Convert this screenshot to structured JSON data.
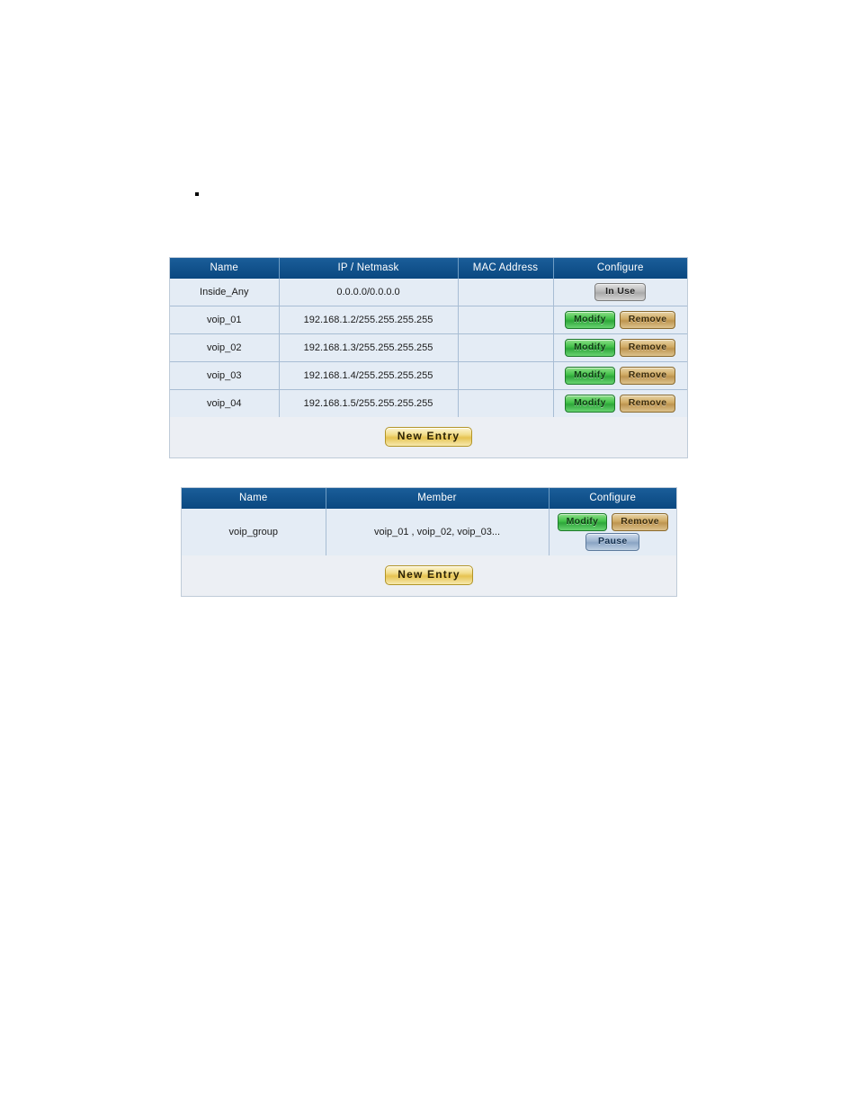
{
  "page": {
    "bullet_marker": "▪"
  },
  "colors": {
    "header_blue": "#0e4d85",
    "cell_blue": "#e4ecf5",
    "panel_gray": "#eceff4",
    "grid_line": "#a8bdd4",
    "modify_green": "#3fbf46",
    "remove_tan": "#cfa962",
    "inuse_gray": "#b9b9b9",
    "pause_blue": "#9db4cf",
    "newentry_gold": "#e6c351"
  },
  "address_table": {
    "columns": [
      "Name",
      "IP / Netmask",
      "MAC Address",
      "Configure"
    ],
    "rows": [
      {
        "name": "Inside_Any",
        "ip_netmask": "0.0.0.0/0.0.0.0",
        "mac_address": "",
        "actions": [
          {
            "label": "In Use",
            "style": "inuse"
          }
        ]
      },
      {
        "name": "voip_01",
        "ip_netmask": "192.168.1.2/255.255.255.255",
        "mac_address": "",
        "actions": [
          {
            "label": "Modify",
            "style": "modify"
          },
          {
            "label": "Remove",
            "style": "remove"
          }
        ]
      },
      {
        "name": "voip_02",
        "ip_netmask": "192.168.1.3/255.255.255.255",
        "mac_address": "",
        "actions": [
          {
            "label": "Modify",
            "style": "modify"
          },
          {
            "label": "Remove",
            "style": "remove"
          }
        ]
      },
      {
        "name": "voip_03",
        "ip_netmask": "192.168.1.4/255.255.255.255",
        "mac_address": "",
        "actions": [
          {
            "label": "Modify",
            "style": "modify"
          },
          {
            "label": "Remove",
            "style": "remove"
          }
        ]
      },
      {
        "name": "voip_04",
        "ip_netmask": "192.168.1.5/255.255.255.255",
        "mac_address": "",
        "actions": [
          {
            "label": "Modify",
            "style": "modify"
          },
          {
            "label": "Remove",
            "style": "remove"
          }
        ]
      }
    ],
    "new_entry_label": "New Entry"
  },
  "group_table": {
    "columns": [
      "Name",
      "Member",
      "Configure"
    ],
    "rows": [
      {
        "name": "voip_group",
        "member": "voip_01 , voip_02, voip_03...",
        "actions_top": [
          {
            "label": "Modify",
            "style": "modify"
          },
          {
            "label": "Remove",
            "style": "remove"
          }
        ],
        "actions_bottom": [
          {
            "label": "Pause",
            "style": "pause"
          }
        ]
      }
    ],
    "new_entry_label": "New Entry"
  }
}
